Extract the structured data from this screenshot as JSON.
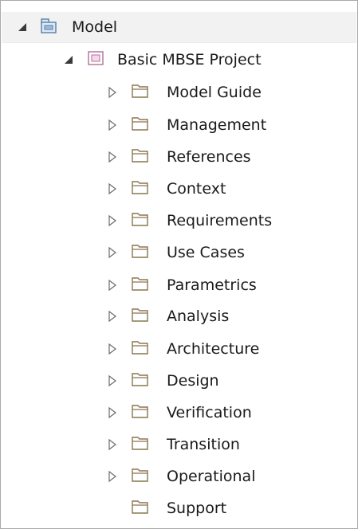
{
  "tree": {
    "root": {
      "label": "Model",
      "expanded": true,
      "icon": "model-package-icon"
    },
    "project": {
      "label": "Basic MBSE Project",
      "expanded": true,
      "icon": "project-package-icon"
    },
    "folders": [
      {
        "id": "model-guide",
        "label": "Model Guide",
        "has_children": true
      },
      {
        "id": "management",
        "label": "Management",
        "has_children": true
      },
      {
        "id": "references",
        "label": "References",
        "has_children": true
      },
      {
        "id": "context",
        "label": "Context",
        "has_children": true
      },
      {
        "id": "requirements",
        "label": "Requirements",
        "has_children": true
      },
      {
        "id": "use-cases",
        "label": "Use Cases",
        "has_children": true
      },
      {
        "id": "parametrics",
        "label": "Parametrics",
        "has_children": true
      },
      {
        "id": "analysis",
        "label": "Analysis",
        "has_children": true
      },
      {
        "id": "architecture",
        "label": "Architecture",
        "has_children": true
      },
      {
        "id": "design",
        "label": "Design",
        "has_children": true
      },
      {
        "id": "verification",
        "label": "Verification",
        "has_children": true
      },
      {
        "id": "transition",
        "label": "Transition",
        "has_children": true
      },
      {
        "id": "operational",
        "label": "Operational",
        "has_children": true
      },
      {
        "id": "support",
        "label": "Support",
        "has_children": false
      }
    ],
    "colors": {
      "folder_stroke": "#8a7650",
      "folder_fill": "#ffffff",
      "expander_stroke": "#6b6b6b",
      "expanded_fill": "#3a3a3a",
      "root_icon_stroke": "#5b7fa6",
      "root_icon_fill": "#dbe8f5",
      "project_icon_stroke": "#b0709a",
      "project_icon_fill": "#f7d7ec"
    }
  }
}
